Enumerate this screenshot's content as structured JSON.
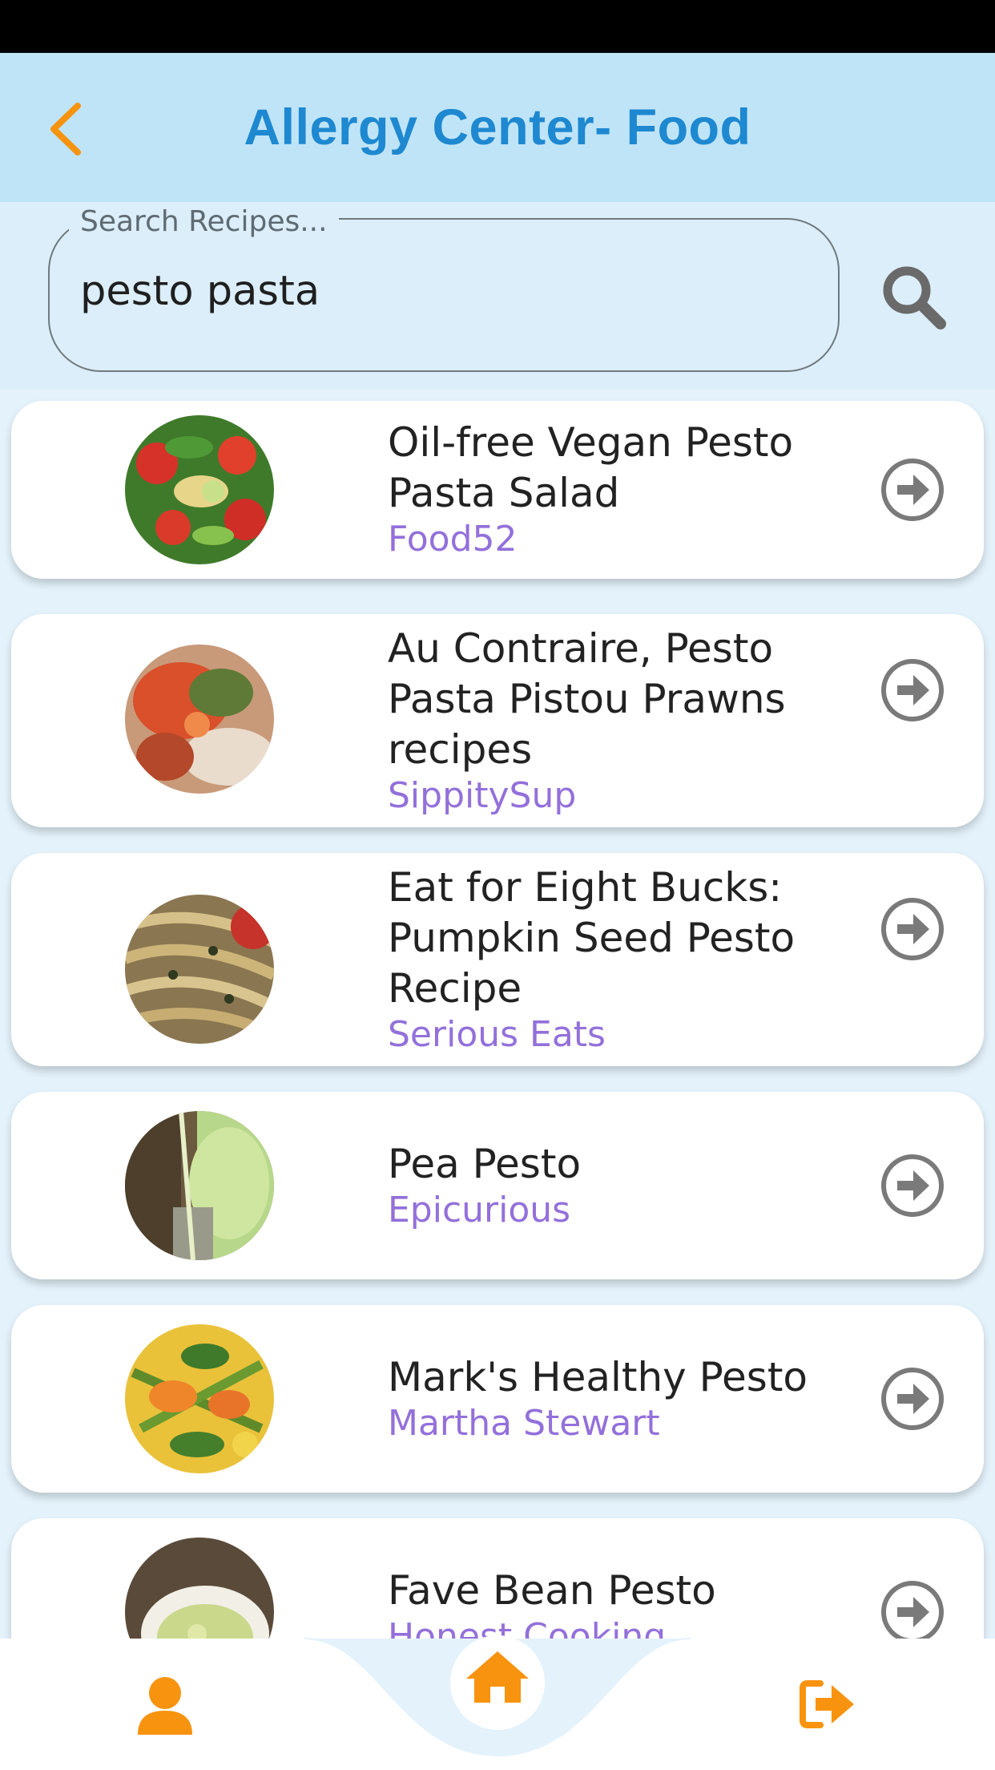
{
  "header": {
    "title": "Allergy Center- Food"
  },
  "search": {
    "label": "Search Recipes...",
    "value": "pesto pasta"
  },
  "recipes": [
    {
      "title": "Oil-free Vegan Pesto Pasta Salad",
      "source": "Food52"
    },
    {
      "title": "Au Contraire, Pesto Pasta Pistou Prawns recipes",
      "source": "SippitySup"
    },
    {
      "title": "Eat for Eight Bucks: Pumpkin Seed Pesto Recipe",
      "source": "Serious Eats"
    },
    {
      "title": "Pea Pesto",
      "source": "Epicurious"
    },
    {
      "title": "Mark's Healthy Pesto",
      "source": "Martha Stewart"
    },
    {
      "title": "Fave Bean Pesto",
      "source": "Honest Cooking"
    }
  ],
  "icons": {
    "back": "chevron-left-icon",
    "search": "search-icon",
    "row_action": "arrow-circle-right-icon",
    "nav_profile": "user-icon",
    "nav_home": "home-icon",
    "nav_logout": "sign-out-icon"
  },
  "colors": {
    "app_bar": "#bfe4f8",
    "title": "#1e88d0",
    "accent_orange": "#f7930e",
    "source_purple": "#9370db",
    "background": "#e4f2fb"
  }
}
